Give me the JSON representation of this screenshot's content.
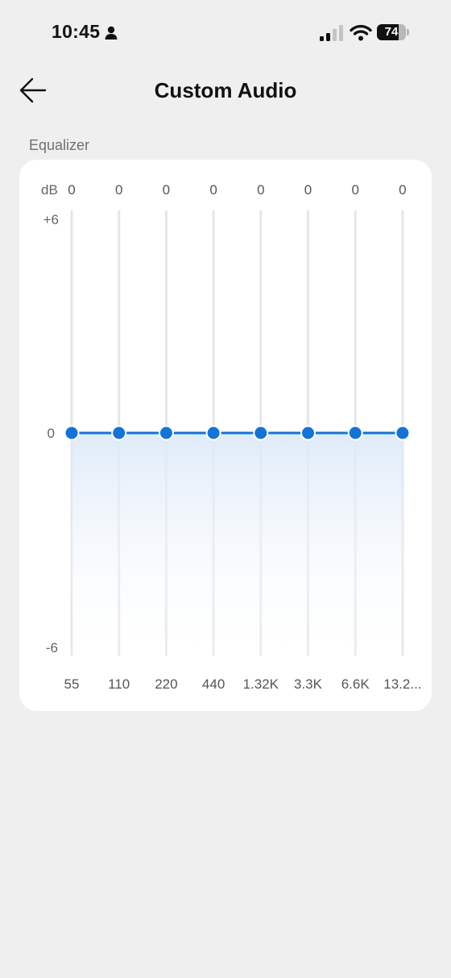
{
  "status_bar": {
    "time": "10:45",
    "battery_level": "74",
    "icons": [
      "person-icon",
      "signal-icon",
      "wifi-icon",
      "battery-icon"
    ]
  },
  "nav": {
    "title": "Custom Audio",
    "back_icon": "arrow-left-icon"
  },
  "equalizer": {
    "section_label": "Equalizer",
    "unit_label": "dB",
    "scale_labels": {
      "max": "+6",
      "mid": "0",
      "min": "-6"
    },
    "range_db": [
      -6,
      6
    ],
    "bands": [
      {
        "freq": "55",
        "value": 0,
        "value_label": "0"
      },
      {
        "freq": "110",
        "value": 0,
        "value_label": "0"
      },
      {
        "freq": "220",
        "value": 0,
        "value_label": "0"
      },
      {
        "freq": "440",
        "value": 0,
        "value_label": "0"
      },
      {
        "freq": "1.32K",
        "value": 0,
        "value_label": "0"
      },
      {
        "freq": "3.3K",
        "value": 0,
        "value_label": "0"
      },
      {
        "freq": "6.6K",
        "value": 0,
        "value_label": "0"
      },
      {
        "freq": "13.2...",
        "value": 0,
        "value_label": "0"
      }
    ],
    "colors": {
      "accent": "#1473d9",
      "track": "#e6e6e6",
      "fill_top": "#dce9f8",
      "point_ring": "#ffffff"
    }
  }
}
